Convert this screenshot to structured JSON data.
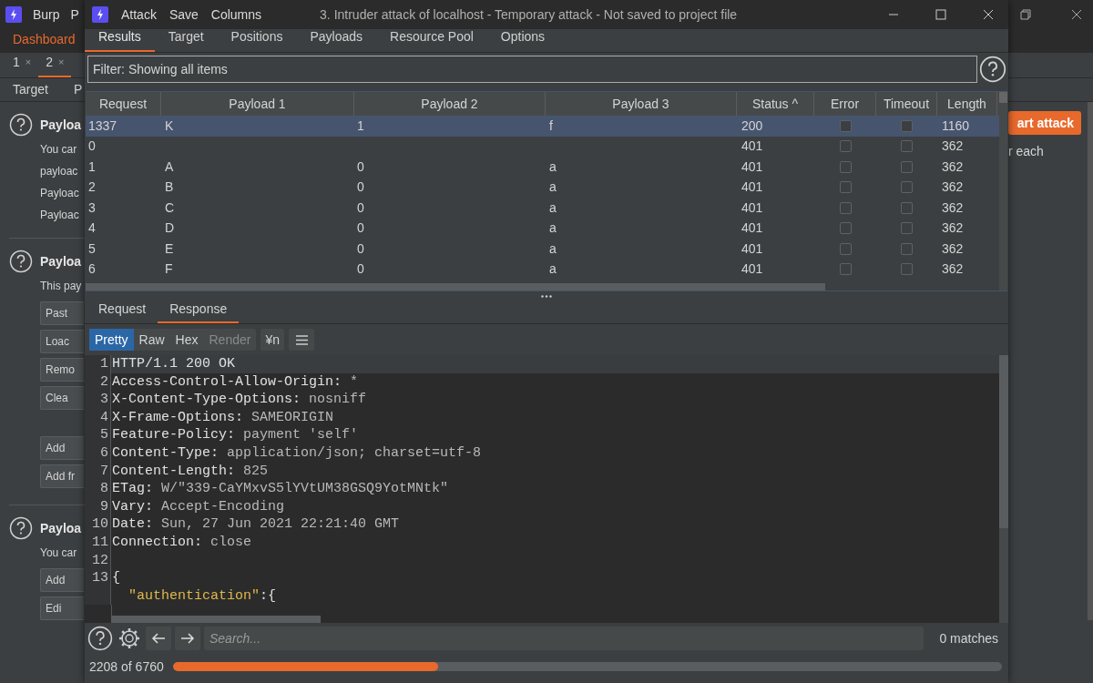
{
  "main_window": {
    "title_items": [
      "Burp",
      "P"
    ],
    "tabs": [
      {
        "label": "Dashboard",
        "selected": true
      }
    ],
    "subtabs": [
      {
        "label": "1",
        "close": "×",
        "selected": false
      },
      {
        "label": "2",
        "close": "×",
        "selected": true
      }
    ],
    "inner_tabs": [
      "Target",
      "P"
    ],
    "sections": [
      {
        "title": "Payloa",
        "lines": [
          "You car",
          "payloac",
          "Payloac",
          "Payloac"
        ]
      },
      {
        "title": "Payloa",
        "lines": [
          "This pay"
        ],
        "buttons": [
          "Past",
          "Loac",
          "Remo",
          "Clea",
          "Add",
          "Add fr"
        ]
      },
      {
        "title": "Payloa",
        "lines": [
          "You car"
        ],
        "buttons": [
          "Add",
          "Edi"
        ]
      }
    ],
    "start_button": "art attack",
    "right_text": "r each"
  },
  "attack_window": {
    "menu": [
      "Attack",
      "Save",
      "Columns"
    ],
    "title": "3. Intruder attack of localhost - Temporary attack - Not saved to project file",
    "tabs": [
      {
        "label": "Results",
        "selected": true
      },
      {
        "label": "Target",
        "selected": false
      },
      {
        "label": "Positions",
        "selected": false
      },
      {
        "label": "Payloads",
        "selected": false
      },
      {
        "label": "Resource Pool",
        "selected": false
      },
      {
        "label": "Options",
        "selected": false
      }
    ],
    "filter": "Filter: Showing all items",
    "table": {
      "columns": [
        "Request",
        "Payload 1",
        "Payload 2",
        "Payload 3",
        "Status ^",
        "Error",
        "Timeout",
        "Length"
      ],
      "rows": [
        {
          "request": "1337",
          "payload_1": "K",
          "payload_2": "1",
          "payload_3": "f",
          "status": "200",
          "error": false,
          "timeout": false,
          "length": "1160",
          "selected": true
        },
        {
          "request": "0",
          "payload_1": "",
          "payload_2": "",
          "payload_3": "",
          "status": "401",
          "error": false,
          "timeout": false,
          "length": "362",
          "selected": false
        },
        {
          "request": "1",
          "payload_1": "A",
          "payload_2": "0",
          "payload_3": "a",
          "status": "401",
          "error": false,
          "timeout": false,
          "length": "362",
          "selected": false
        },
        {
          "request": "2",
          "payload_1": "B",
          "payload_2": "0",
          "payload_3": "a",
          "status": "401",
          "error": false,
          "timeout": false,
          "length": "362",
          "selected": false
        },
        {
          "request": "3",
          "payload_1": "C",
          "payload_2": "0",
          "payload_3": "a",
          "status": "401",
          "error": false,
          "timeout": false,
          "length": "362",
          "selected": false
        },
        {
          "request": "4",
          "payload_1": "D",
          "payload_2": "0",
          "payload_3": "a",
          "status": "401",
          "error": false,
          "timeout": false,
          "length": "362",
          "selected": false
        },
        {
          "request": "5",
          "payload_1": "E",
          "payload_2": "0",
          "payload_3": "a",
          "status": "401",
          "error": false,
          "timeout": false,
          "length": "362",
          "selected": false
        },
        {
          "request": "6",
          "payload_1": "F",
          "payload_2": "0",
          "payload_3": "a",
          "status": "401",
          "error": false,
          "timeout": false,
          "length": "362",
          "selected": false
        }
      ]
    },
    "message_tabs": [
      {
        "label": "Request",
        "selected": false
      },
      {
        "label": "Response",
        "selected": true
      }
    ],
    "view_buttons": [
      {
        "label": "Pretty",
        "selected": true,
        "disabled": false
      },
      {
        "label": "Raw",
        "selected": false,
        "disabled": false
      },
      {
        "label": "Hex",
        "selected": false,
        "disabled": false
      },
      {
        "label": "Render",
        "selected": false,
        "disabled": true
      }
    ],
    "newline_button": "¥n",
    "editor_lines": [
      {
        "number": "1",
        "parts": [
          {
            "kind": "name",
            "text": "HTTP/1.1 200 OK"
          }
        ]
      },
      {
        "number": "2",
        "parts": [
          {
            "kind": "name",
            "text": "Access-Control-Allow-Origin:"
          },
          {
            "kind": "value",
            "text": " *"
          }
        ]
      },
      {
        "number": "3",
        "parts": [
          {
            "kind": "name",
            "text": "X-Content-Type-Options:"
          },
          {
            "kind": "value",
            "text": " nosniff"
          }
        ]
      },
      {
        "number": "4",
        "parts": [
          {
            "kind": "name",
            "text": "X-Frame-Options:"
          },
          {
            "kind": "value",
            "text": " SAMEORIGIN"
          }
        ]
      },
      {
        "number": "5",
        "parts": [
          {
            "kind": "name",
            "text": "Feature-Policy:"
          },
          {
            "kind": "value",
            "text": " payment 'self'"
          }
        ]
      },
      {
        "number": "6",
        "parts": [
          {
            "kind": "name",
            "text": "Content-Type:"
          },
          {
            "kind": "value",
            "text": " application/json; charset=utf-8"
          }
        ]
      },
      {
        "number": "7",
        "parts": [
          {
            "kind": "name",
            "text": "Content-Length:"
          },
          {
            "kind": "value",
            "text": " 825"
          }
        ]
      },
      {
        "number": "8",
        "parts": [
          {
            "kind": "name",
            "text": "ETag:"
          },
          {
            "kind": "value",
            "text": " W/\"339-CaYMxvS5lYVtUM38GSQ9YotMNtk\""
          }
        ]
      },
      {
        "number": "9",
        "parts": [
          {
            "kind": "name",
            "text": "Vary:"
          },
          {
            "kind": "value",
            "text": " Accept-Encoding"
          }
        ]
      },
      {
        "number": "10",
        "parts": [
          {
            "kind": "name",
            "text": "Date:"
          },
          {
            "kind": "value",
            "text": " Sun, 27 Jun 2021 22:21:40 GMT"
          }
        ]
      },
      {
        "number": "11",
        "parts": [
          {
            "kind": "name",
            "text": "Connection:"
          },
          {
            "kind": "value",
            "text": " close"
          }
        ]
      },
      {
        "number": "12"
      },
      {
        "number": "13",
        "parts": [
          {
            "kind": "name",
            "text": "{"
          }
        ]
      },
      {
        "parts": [
          {
            "kind": "key",
            "text": "  \"authentication\""
          },
          {
            "kind": "name",
            "text": ":{"
          }
        ]
      }
    ],
    "search_placeholder": "Search...",
    "matches": "0 matches",
    "progress": {
      "text": "2208 of 6760",
      "level": 0.32
    }
  }
}
